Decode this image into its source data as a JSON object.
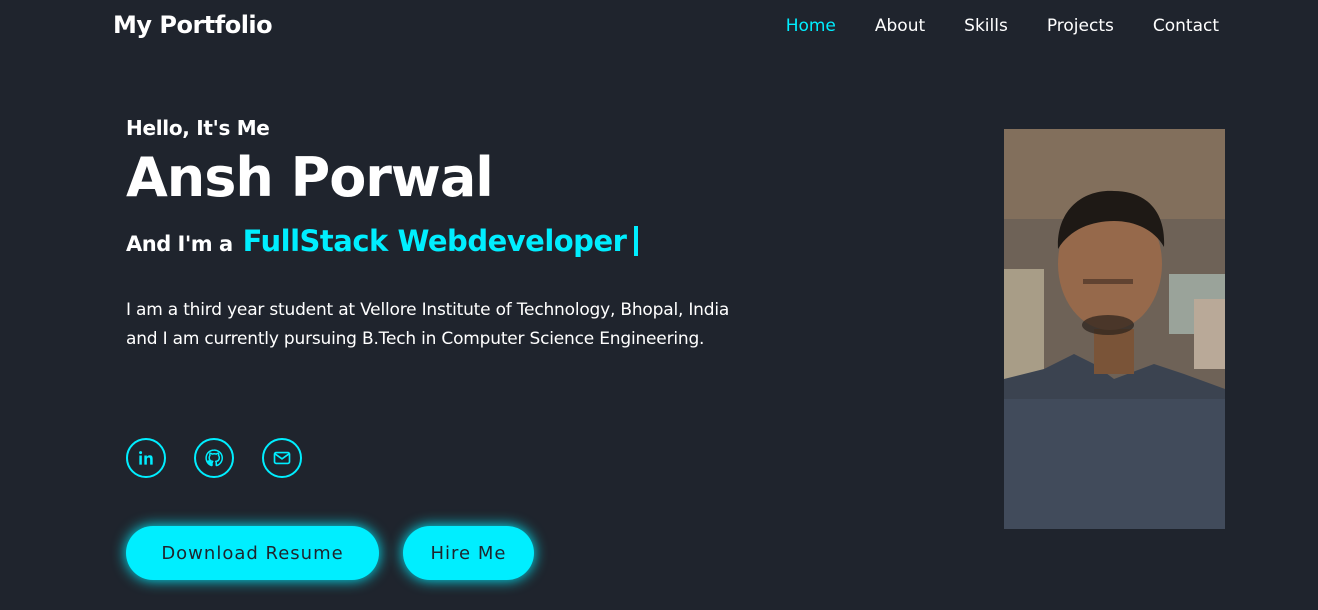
{
  "header": {
    "logo": "My Portfolio",
    "nav": [
      "Home",
      "About",
      "Skills",
      "Projects",
      "Contact"
    ],
    "active_nav": "Home"
  },
  "hero": {
    "greeting": "Hello, It's Me",
    "name": "Ansh Porwal",
    "role_prefix": "And I'm a",
    "role": "FullStack Webdeveloper",
    "description": "I am a third year student at Vellore Institute of Technology, Bhopal, India and I am currently pursuing B.Tech in Computer Science Engineering."
  },
  "socials": [
    "linkedin-icon",
    "github-icon",
    "mail-icon"
  ],
  "buttons": {
    "resume": "Download Resume",
    "hire": "Hire Me"
  },
  "colors": {
    "background": "#1f242d",
    "accent": "#00eeff",
    "text": "#ffffff"
  }
}
